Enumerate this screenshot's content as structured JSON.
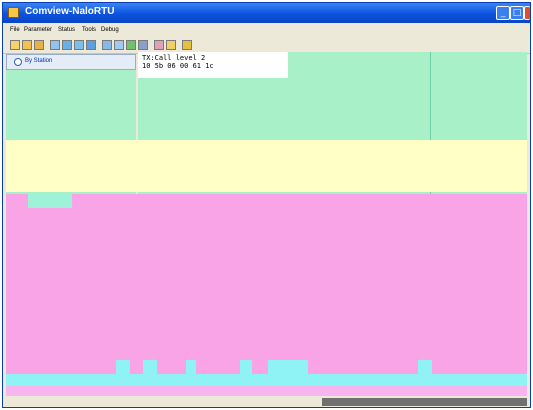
{
  "window": {
    "title": "Comview-NaloRTU"
  },
  "titlebar_buttons": {
    "minimize": "_",
    "maximize": "□",
    "close": "×"
  },
  "menu": {
    "items": [
      "File",
      "Parameter",
      "Status",
      "Tools",
      "Debug"
    ]
  },
  "toolbar": {
    "icons": [
      "open-icon",
      "edit-icon",
      "save-icon",
      "grid-icon",
      "table-icon",
      "chart-icon",
      "list-icon",
      "window-icon",
      "copy-icon",
      "refresh-icon",
      "settings-icon",
      "stop-icon",
      "bookmark-icon",
      "help-icon"
    ]
  },
  "sidebar": {
    "header_label": "By Station"
  },
  "console": {
    "line1": "TX:Call level 2",
    "line2": "10 5b 06 00 61 1c"
  },
  "colors": {
    "titlebar": "#0c52de",
    "workspace_green": "#a8f0c8",
    "workspace_yellow": "#ffffc6",
    "workspace_pink": "#f8a4e6",
    "workspace_cyan": "#8ff2f4"
  }
}
